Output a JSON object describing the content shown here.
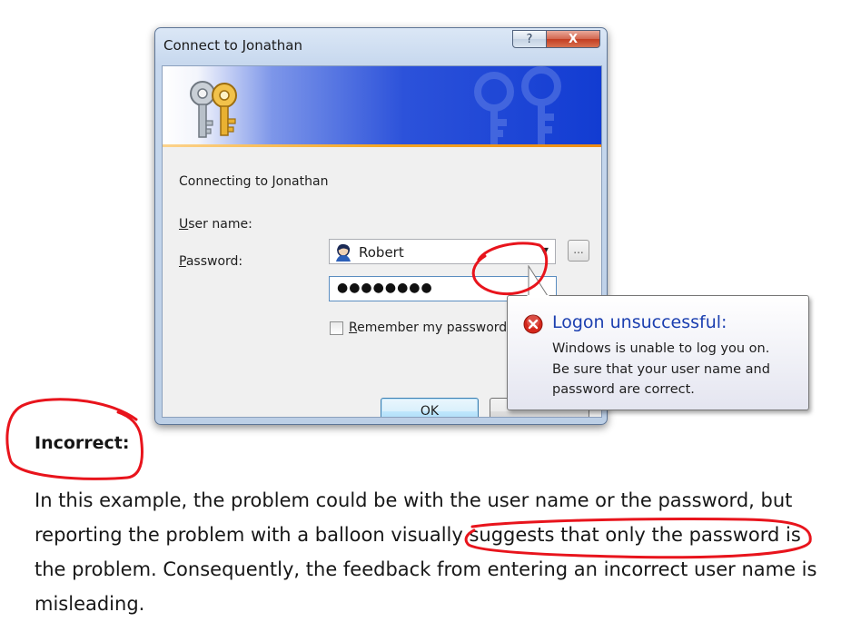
{
  "dialog": {
    "title": "Connect to Jonathan",
    "help_button": "?",
    "close_button": "X",
    "connecting_text": "Connecting to Jonathan",
    "username_label_underlined": "U",
    "username_label_rest": "ser name:",
    "username_value": "Robert",
    "browse_button": "...",
    "password_label_underlined": "P",
    "password_label_rest": "assword:",
    "password_value": "●●●●●●●●",
    "remember_checked": false,
    "remember_label_underlined": "R",
    "remember_label_rest": "emember my password",
    "ok_button": "OK"
  },
  "balloon": {
    "title": "Logon unsuccessful:",
    "lines": [
      "Windows is unable to log you on.",
      "Be sure that your user name and",
      "password are correct."
    ]
  },
  "article": {
    "heading": "Incorrect:",
    "paragraph_lines": [
      "In this example, the problem could be with the user name or the password, but",
      "reporting the problem with a balloon visually suggests that only the password is",
      "the problem. Consequently, the feedback from entering an incorrect user name is",
      "misleading."
    ]
  },
  "colors": {
    "annotation_red": "#e8141c",
    "balloon_title_blue": "#1b3fb0",
    "banner_blue": "#123cd2",
    "error_red": "#d4271b"
  },
  "icons": [
    "keys-icon",
    "user-avatar-icon",
    "error-icon",
    "dropdown-arrow-icon"
  ]
}
